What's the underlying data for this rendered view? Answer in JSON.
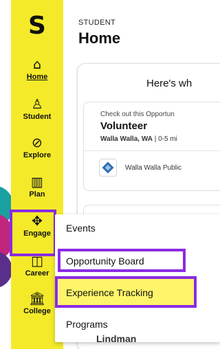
{
  "sidebar": {
    "logo": "S",
    "items": [
      {
        "id": "home",
        "label": "Home",
        "icon": "home-icon",
        "glyph": "⌂"
      },
      {
        "id": "student",
        "label": "Student",
        "icon": "student-icon",
        "glyph": "♙"
      },
      {
        "id": "explore",
        "label": "Explore",
        "icon": "compass-icon",
        "glyph": "⊘"
      },
      {
        "id": "plan",
        "label": "Plan",
        "icon": "map-icon",
        "glyph": "▥"
      },
      {
        "id": "engage",
        "label": "Engage",
        "icon": "handshake-icon",
        "glyph": "✥"
      },
      {
        "id": "career",
        "label": "Career",
        "icon": "briefcase-icon",
        "glyph": "◫"
      },
      {
        "id": "college",
        "label": "College",
        "icon": "college-icon",
        "glyph": "⌂"
      }
    ],
    "active": "home",
    "bg_color": "#f4ea2a",
    "highlight_color": "#8a2be2"
  },
  "header": {
    "section": "STUDENT",
    "title": "Home"
  },
  "main": {
    "heading": "Here's wh",
    "opportunity": {
      "prompt": "Check out this Opportun",
      "title": "Volunteer",
      "location": "Walla Walla, WA",
      "distance": " | 0-5 mi",
      "org": "Walla Walla Public"
    },
    "peek_text": "Lindman"
  },
  "engage_menu": {
    "items": [
      "Events",
      "Opportunity Board",
      "Experience Tracking",
      "Programs"
    ],
    "highlight_color": "#fff56a"
  }
}
